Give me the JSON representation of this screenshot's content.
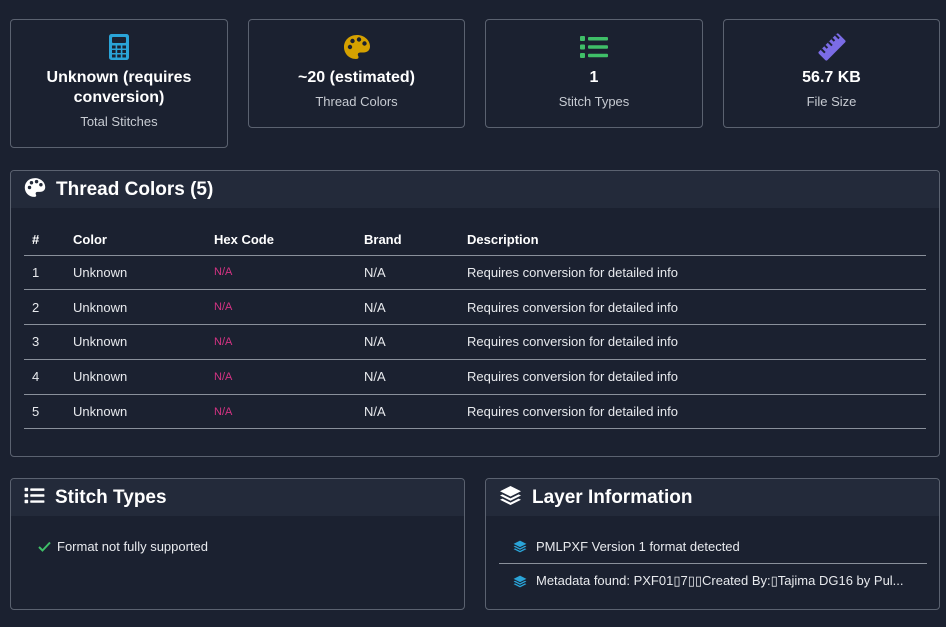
{
  "stats": [
    {
      "icon": "calculator-icon",
      "value": "Unknown (requires conversion)",
      "label": "Total Stitches",
      "color": "#2aa4d8"
    },
    {
      "icon": "palette-icon",
      "value": "~20 (estimated)",
      "label": "Thread Colors",
      "color": "#d5a100"
    },
    {
      "icon": "list-icon",
      "value": "1",
      "label": "Stitch Types",
      "color": "#3fbf68"
    },
    {
      "icon": "ruler-icon",
      "value": "56.7 KB",
      "label": "File Size",
      "color": "#7b6ce6"
    }
  ],
  "thread_colors": {
    "title": "Thread Colors (5)",
    "columns": [
      "#",
      "Color",
      "Hex Code",
      "Brand",
      "Description"
    ],
    "rows": [
      [
        "1",
        "Unknown",
        "N/A",
        "N/A",
        "Requires conversion for detailed info"
      ],
      [
        "2",
        "Unknown",
        "N/A",
        "N/A",
        "Requires conversion for detailed info"
      ],
      [
        "3",
        "Unknown",
        "N/A",
        "N/A",
        "Requires conversion for detailed info"
      ],
      [
        "4",
        "Unknown",
        "N/A",
        "N/A",
        "Requires conversion for detailed info"
      ],
      [
        "5",
        "Unknown",
        "N/A",
        "N/A",
        "Requires conversion for detailed info"
      ]
    ],
    "hex_color": "#d63384"
  },
  "stitch_types": {
    "title": "Stitch Types",
    "items": [
      "Format not fully supported"
    ],
    "check_color": "#3fbf68"
  },
  "layer_info": {
    "title": "Layer Information",
    "items": [
      "PMLPXF Version 1 format detected",
      "Metadata found: PXF01▯7▯▯Created By:▯Tajima DG16 by Pul..."
    ],
    "icon_color": "#2aa4d8"
  }
}
